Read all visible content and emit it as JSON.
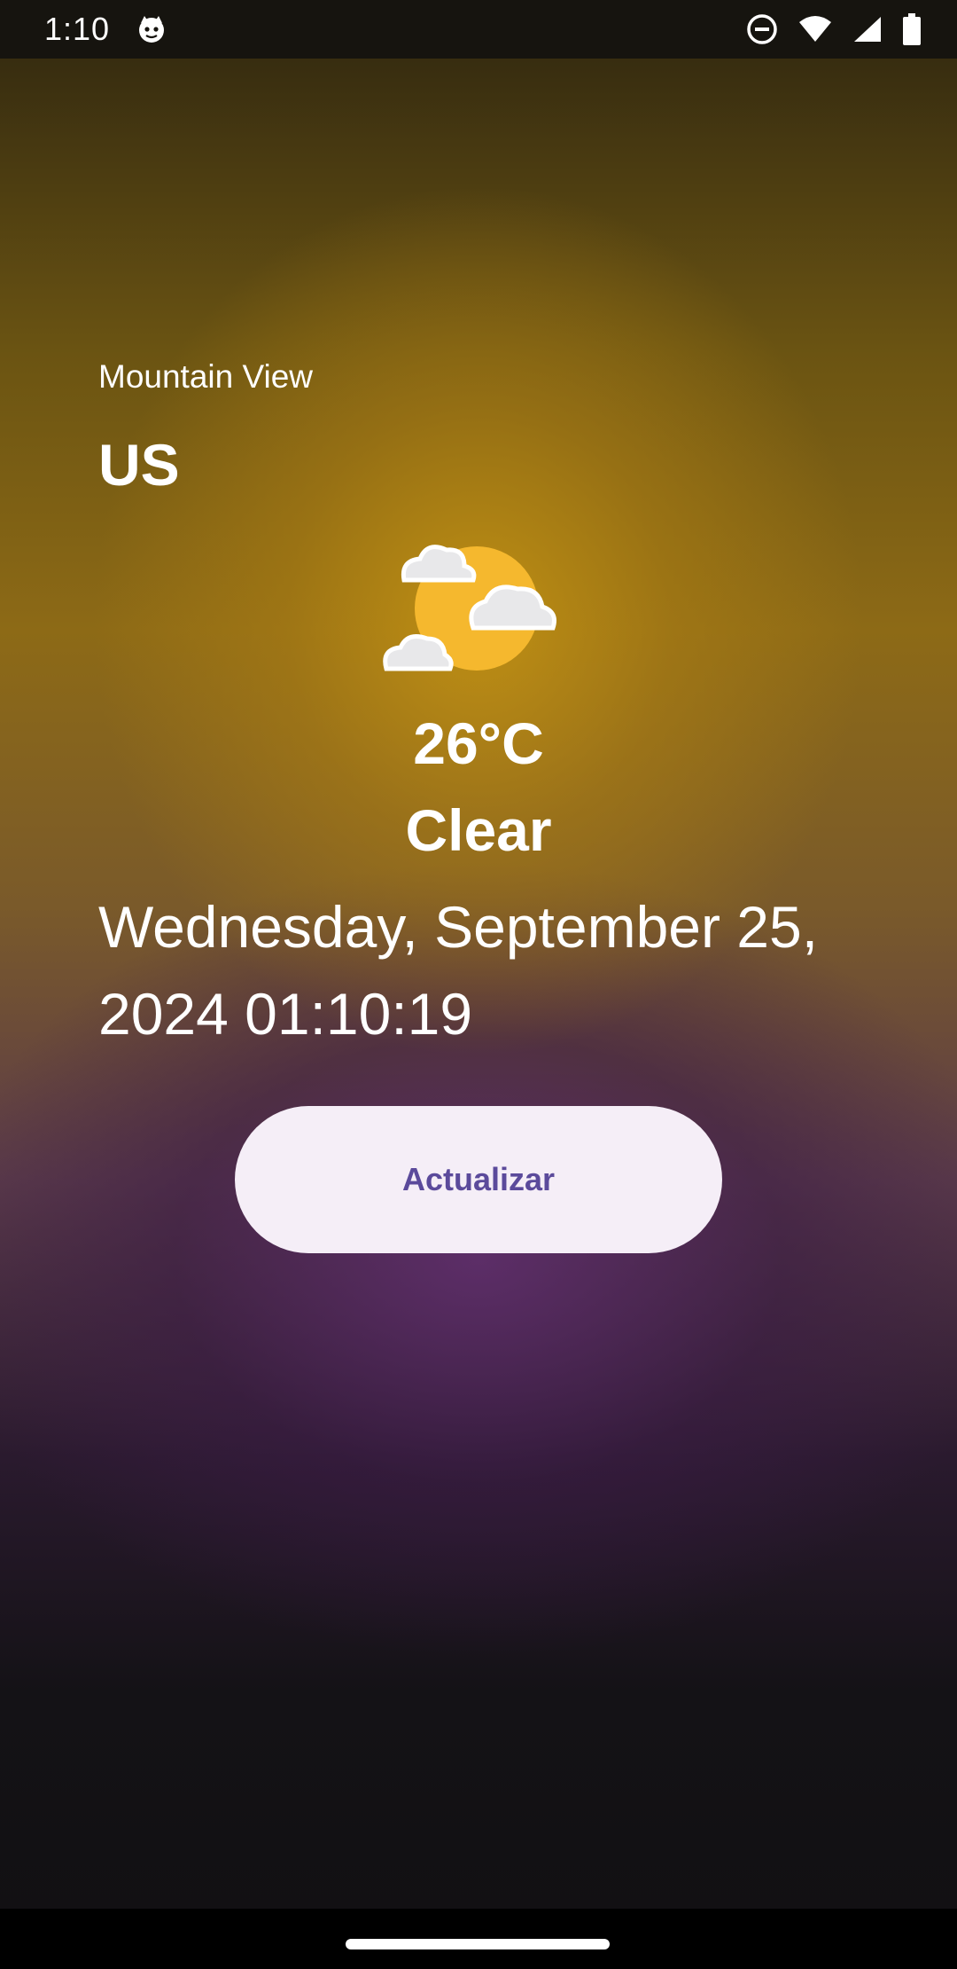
{
  "status_bar": {
    "time": "1:10",
    "app_icon": "cat-face-icon",
    "icons": [
      "do-not-disturb-icon",
      "wifi-icon",
      "cellular-signal-icon",
      "battery-icon"
    ]
  },
  "location": {
    "city": "Mountain View",
    "country": "US"
  },
  "weather": {
    "icon": "sun-behind-clouds-icon",
    "temperature": "26°C",
    "condition": "Clear"
  },
  "datetime": "Wednesday, September 25, 2024 01:10:19",
  "actions": {
    "refresh_label": "Actualizar"
  },
  "colors": {
    "button_background": "#f5eef7",
    "button_text": "#5b4a9b",
    "sun": "#f5b82e",
    "text": "#ffffff"
  }
}
